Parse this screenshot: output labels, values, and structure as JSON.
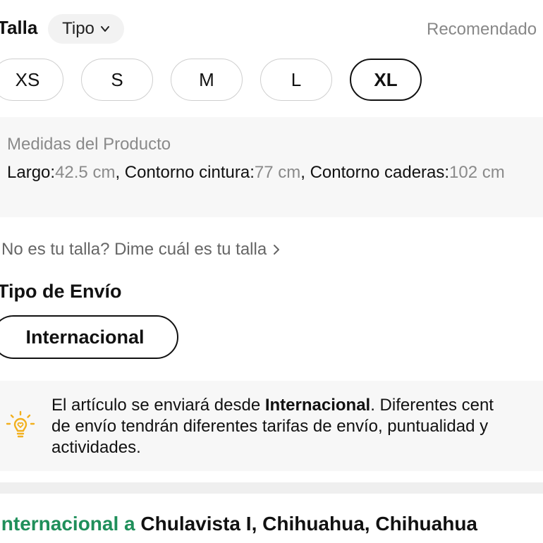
{
  "size_section": {
    "title": "Talla",
    "type_button": "Tipo",
    "sort_label": "Recomendado",
    "sizes": [
      "XS",
      "S",
      "M",
      "L",
      "XL"
    ],
    "selected_size": "XL"
  },
  "measurements": {
    "title": "Medidas del Producto",
    "largo_label": "Largo:",
    "largo_value": "42.5 cm",
    "cintura_label": "Contorno cintura:",
    "cintura_value": "77 cm",
    "caderas_label": "Contorno caderas:",
    "caderas_value": "102 cm",
    "separator": ", "
  },
  "size_help": "No es tu talla? Dime cuál es tu talla",
  "shipping": {
    "title": "Tipo de Envío",
    "option": "Internacional",
    "notice_prefix": "El artículo se enviará desde ",
    "notice_bold": "Internacional",
    "notice_suffix": ". Diferentes cent",
    "notice_line2": "de envío tendrán diferentes tarifas de envío, puntualidad y",
    "notice_line3": "actividades.",
    "route_prefix": "Internacional a ",
    "destination": "Chulavista I, Chihuahua, Chihuahua"
  },
  "colors": {
    "accent_green": "#1f8f5a",
    "bulb_yellow": "#f2b01e",
    "muted_text": "#8a8a8a"
  },
  "icons": {
    "type_dropdown": "chevron-down-icon",
    "size_help": "chevron-right-icon",
    "notice": "lightbulb-heart-icon"
  }
}
